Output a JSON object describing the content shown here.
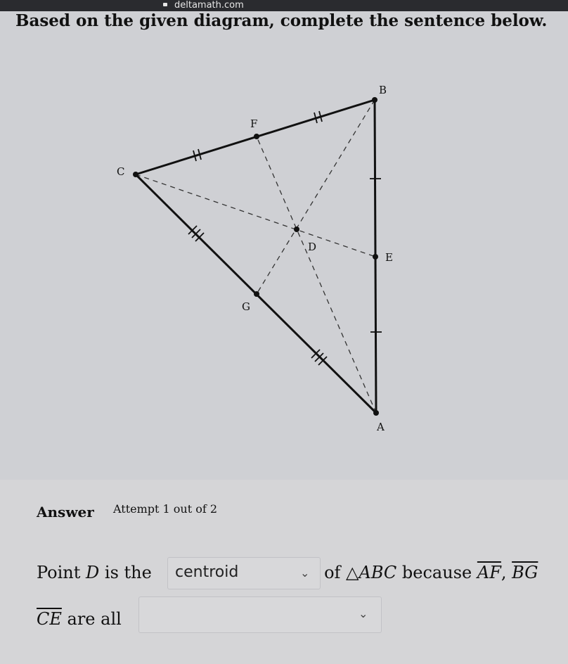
{
  "browser": {
    "url": "deltamath.com"
  },
  "question": {
    "prompt": "Based on the given diagram, complete the sentence below."
  },
  "diagram": {
    "points": {
      "A": "A",
      "B": "B",
      "C": "C",
      "D": "D",
      "E": "E",
      "F": "F",
      "G": "G"
    }
  },
  "answer": {
    "label": "Answer",
    "attempt": "Attempt 1 out of 2",
    "sentence": {
      "part1": "Point ",
      "point": "D",
      "part2": " is the ",
      "part3": " of △",
      "triangle": "ABC",
      "part4": " because ",
      "seg1": "AF",
      "comma1": ", ",
      "seg2": "BG",
      "seg3": "CE",
      "part5": " are all ",
      "period": "."
    },
    "dropdown1": {
      "selected": "centroid"
    },
    "dropdown2": {
      "selected": ""
    }
  }
}
